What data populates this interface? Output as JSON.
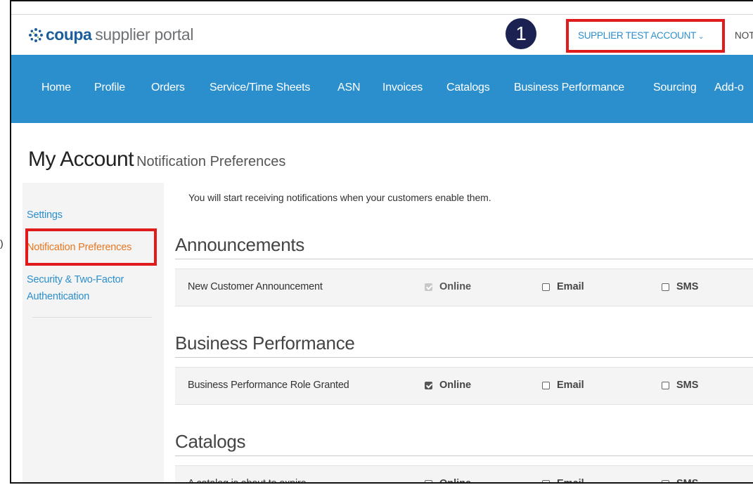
{
  "header": {
    "logo_brand": "coupa",
    "logo_rest": "supplier portal",
    "step_number": "1",
    "account_name": "SUPPLIER TEST ACCOUNT",
    "account_chevron": "⌄",
    "notifications_truncated": "NOT"
  },
  "nav": {
    "items": [
      {
        "label": "Home"
      },
      {
        "label": "Profile"
      },
      {
        "label": "Orders"
      },
      {
        "label": "Service/Time Sheets"
      },
      {
        "label": "ASN"
      },
      {
        "label": "Invoices"
      },
      {
        "label": "Catalogs"
      },
      {
        "label": "Business Performance"
      },
      {
        "label": "Sourcing"
      },
      {
        "label": "Add-o"
      }
    ]
  },
  "page": {
    "title": "My Account",
    "subtitle": "Notification Preferences",
    "info": "You will start receiving notifications when your customers enable them."
  },
  "sidebar": {
    "items": [
      {
        "label": "Settings"
      },
      {
        "label": "Notification Preferences"
      },
      {
        "label": "Security & Two-Factor"
      },
      {
        "label": "Authentication"
      }
    ]
  },
  "sections": [
    {
      "heading": "Announcements",
      "row": {
        "label": "New Customer Announcement",
        "online": "Online",
        "email": "Email",
        "sms": "SMS",
        "online_checked": true,
        "online_disabled": true,
        "email_checked": false,
        "sms_checked": false
      }
    },
    {
      "heading": "Business Performance",
      "row": {
        "label": "Business Performance Role Granted",
        "online": "Online",
        "email": "Email",
        "sms": "SMS",
        "online_checked": true,
        "online_disabled": false,
        "email_checked": false,
        "sms_checked": false
      }
    },
    {
      "heading": "Catalogs",
      "row": {
        "label": "A catalog is about to expire",
        "online": "Online",
        "email": "Email",
        "sms": "SMS",
        "online_checked": false,
        "online_disabled": false,
        "email_checked": false,
        "sms_checked": false
      }
    }
  ],
  "colors": {
    "brand_blue": "#2b8fce",
    "nav_bg": "#2b8fce",
    "highlight_red": "#e01b1b",
    "active_orange": "#e87722",
    "badge_navy": "#1b2150"
  }
}
